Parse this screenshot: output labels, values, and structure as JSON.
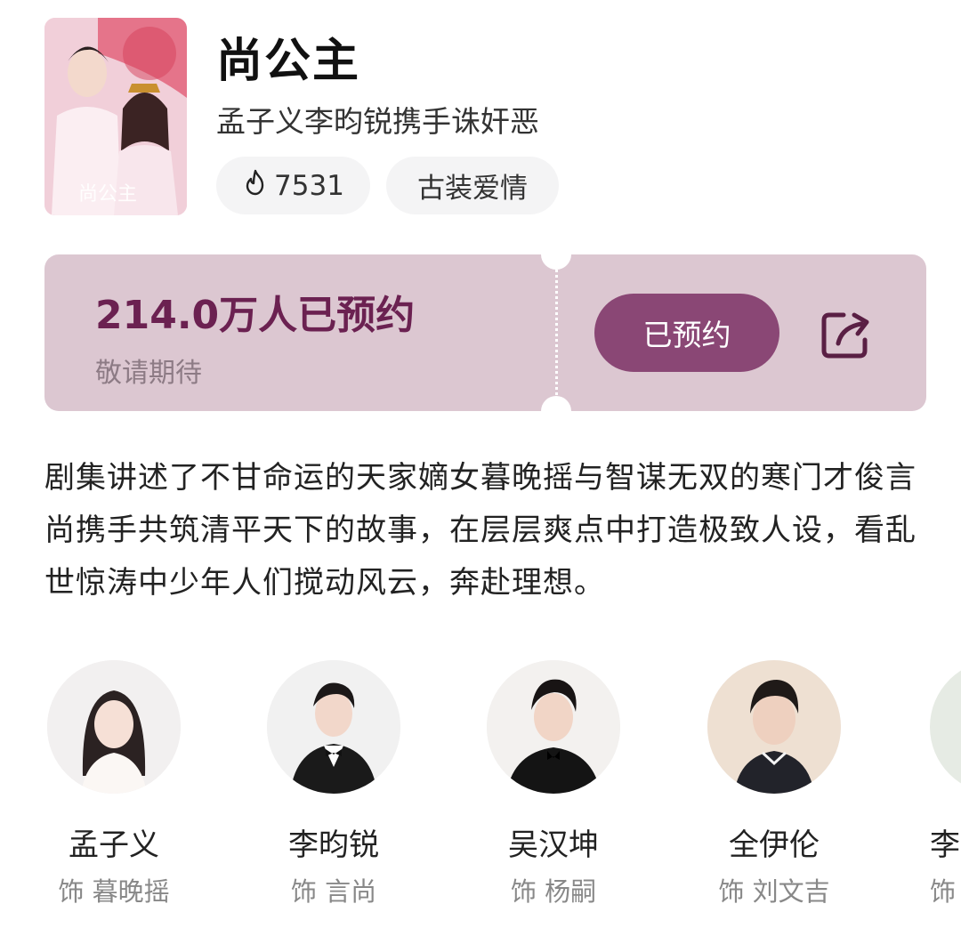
{
  "show": {
    "title": "尚公主",
    "subtitle": "孟子义李昀锐携手诛奸恶",
    "heat_value": "7531",
    "genre_tag": "古装爱情",
    "poster_text": "尚公主"
  },
  "reservation": {
    "count_text": "214.0万人已预约",
    "note": "敬请期待",
    "button_label": "已预约",
    "accent_color": "#8a4775"
  },
  "synopsis": "剧集讲述了不甘命运的天家嫡女暮晚摇与智谋无双的寒门才俊言尚携手共筑清平天下的故事，在层层爽点中打造极致人设，看乱世惊涛中少年人们搅动风云，奔赴理想。",
  "cast": [
    {
      "name": "孟子义",
      "role": "饰 暮晚摇"
    },
    {
      "name": "李昀锐",
      "role": "饰 言尚"
    },
    {
      "name": "吴汉坤",
      "role": "饰 杨嗣"
    },
    {
      "name": "全伊伦",
      "role": "饰 刘文吉"
    },
    {
      "name": "李",
      "role": "饰"
    }
  ],
  "icons": {
    "heat": "flame-icon",
    "share": "share-icon"
  }
}
